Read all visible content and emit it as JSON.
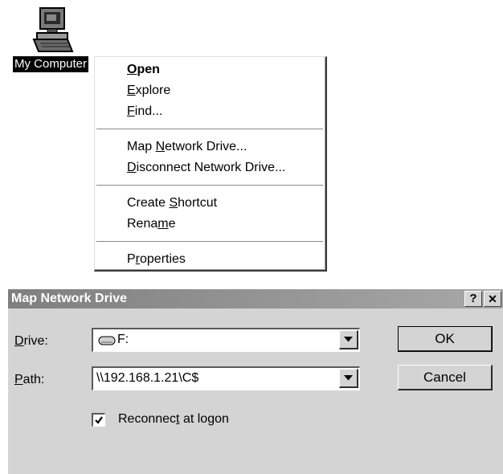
{
  "desktop": {
    "icon": {
      "label": "My Computer",
      "icon_name": "my-computer-icon"
    }
  },
  "context_menu": {
    "groups": [
      [
        {
          "label": "Open",
          "accel": "O",
          "bold": true
        },
        {
          "label": "Explore",
          "accel": "E"
        },
        {
          "label": "Find...",
          "accel": "F"
        }
      ],
      [
        {
          "label": "Map Network Drive...",
          "accel": "N"
        },
        {
          "label": "Disconnect Network Drive...",
          "accel": "D"
        }
      ],
      [
        {
          "label": "Create Shortcut",
          "accel": "S"
        },
        {
          "label": "Rename",
          "accel": "m"
        }
      ],
      [
        {
          "label": "Properties",
          "accel": "r"
        }
      ]
    ]
  },
  "dialog": {
    "title": "Map Network Drive",
    "help_button": "?",
    "close_button": "✕",
    "drive": {
      "label": "Drive:",
      "accel": "D",
      "value": "F:",
      "icon_name": "drive-icon"
    },
    "path": {
      "label": "Path:",
      "accel": "P",
      "value": "\\\\192.168.1.21\\C$"
    },
    "reconnect": {
      "label": "Reconnect at logon",
      "accel": "t",
      "checked": true
    },
    "ok_label": "OK",
    "cancel_label": "Cancel"
  }
}
